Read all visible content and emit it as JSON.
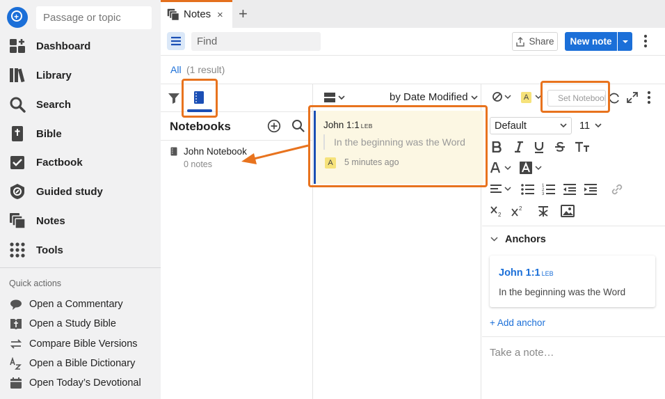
{
  "sidebar": {
    "search_placeholder": "Passage or topic",
    "nav": [
      {
        "label": "Dashboard",
        "icon": "dashboard-icon"
      },
      {
        "label": "Library",
        "icon": "library-icon"
      },
      {
        "label": "Search",
        "icon": "search-icon"
      },
      {
        "label": "Bible",
        "icon": "bible-icon"
      },
      {
        "label": "Factbook",
        "icon": "factbook-icon"
      },
      {
        "label": "Guided study",
        "icon": "guided-study-icon"
      },
      {
        "label": "Notes",
        "icon": "notes-icon"
      },
      {
        "label": "Tools",
        "icon": "tools-icon"
      }
    ],
    "quick_actions_title": "Quick actions",
    "quick_actions": [
      {
        "label": "Open a Commentary",
        "icon": "commentary-icon"
      },
      {
        "label": "Open a Study Bible",
        "icon": "study-bible-icon"
      },
      {
        "label": "Compare Bible Versions",
        "icon": "compare-icon"
      },
      {
        "label": "Open a Bible Dictionary",
        "icon": "dictionary-icon"
      },
      {
        "label": "Open Today’s Devotional",
        "icon": "calendar-icon"
      }
    ]
  },
  "tabs": {
    "active": {
      "label": "Notes",
      "icon": "notes-icon",
      "close": "×"
    },
    "add": "+"
  },
  "toolbar": {
    "find_placeholder": "Find",
    "share_label": "Share",
    "new_note_label": "New note"
  },
  "filter": {
    "all_label": "All",
    "count_label": "(1 result)"
  },
  "notebooks": {
    "title": "Notebooks",
    "items": [
      {
        "name": "John Notebook",
        "count": "0 notes"
      }
    ]
  },
  "notes_list": {
    "sort_label": "by Date Modified",
    "notes": [
      {
        "reference": "John 1:1",
        "version": "LEB",
        "quote": "In the beginning was the Word",
        "badge": "A",
        "time": "5 minutes ago"
      }
    ]
  },
  "editor": {
    "highlight_badge": "A",
    "set_notebook_placeholder": "Set Notebook",
    "font_family": "Default",
    "font_size": "11",
    "anchors_title": "Anchors",
    "anchor": {
      "reference": "John 1:1",
      "version": "LEB",
      "text": "In the beginning was the Word"
    },
    "add_anchor_label": "+ Add anchor",
    "note_placeholder": "Take a note…"
  },
  "colors": {
    "accent": "#1b6fd8",
    "highlight_outline": "#e8731e",
    "note_card_bg": "#fcf7e3",
    "sidebar_bg": "#f1f1f2"
  }
}
